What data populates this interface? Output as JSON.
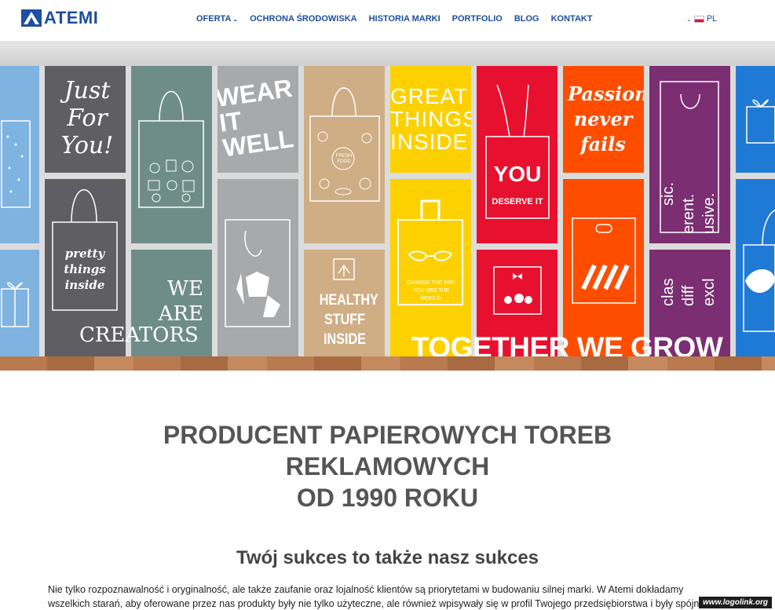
{
  "brand": {
    "name": "ATEMI",
    "color": "#1e4fa0"
  },
  "nav": {
    "items": [
      {
        "label": "OFERTA",
        "has_dropdown": true
      },
      {
        "label": "OCHRONA ŚRODOWISKA"
      },
      {
        "label": "HISTORIA MARKI"
      },
      {
        "label": "PORTFOLIO"
      },
      {
        "label": "BLOG"
      },
      {
        "label": "KONTAKT"
      }
    ],
    "language": "PL"
  },
  "hero": {
    "panels": {
      "just_for_you": "Just For You!",
      "wear_it_well": "WEAR IT WELL",
      "great_things_inside": "GREAT THINGS INSIDE",
      "passion_never_fails": "Passion never fails",
      "you": "YOU",
      "deserve_it": "DESERVE IT",
      "pretty_things_inside": "pretty things inside",
      "we_are": "WE ARE",
      "creators": "CREATORS",
      "healthy_stuff_inside": "HEALTHY STUFF INSIDE",
      "change_the_way": "CHANGE THE WAY YOU SEE THE WORLD.",
      "fresh_food": "FRESH FOOD",
      "vertical_1": "sic.",
      "vertical_2": "erent.",
      "vertical_3": "usive.",
      "vertical_4": "clas",
      "vertical_5": "diff",
      "vertical_6": "excl"
    },
    "slogan": "TOGETHER WE GROW",
    "colors": {
      "blue": "#7fb3e0",
      "dark_gray": "#5e5e63",
      "teal": "#6f8d88",
      "gray": "#a8a9aa",
      "tan": "#cfae85",
      "yellow": "#fdd100",
      "red": "#e8102f",
      "orange": "#ff4d00",
      "purple": "#7b2e72",
      "bright_blue": "#1f7ad6"
    }
  },
  "main": {
    "headline_lines": [
      "PRODUCENT PAPIEROWYCH TOREB",
      "REKLAMOWYCH",
      "OD 1990 ROKU"
    ],
    "subheadline": "Twój sukces to także nasz sukces",
    "paragraph": "Nie tylko rozpoznawalność i oryginalność, ale także zaufanie oraz lojalność klientów są priorytetami w budowaniu silnej marki. W Atemi dokładamy wszelkich starań, aby oferowane przez nas produkty były nie tylko użyteczne, ale również wpisywały się w profil Twojego przedsiębiorstwa i były spójne z jego strategią"
  },
  "watermark": "www.logolink.org"
}
